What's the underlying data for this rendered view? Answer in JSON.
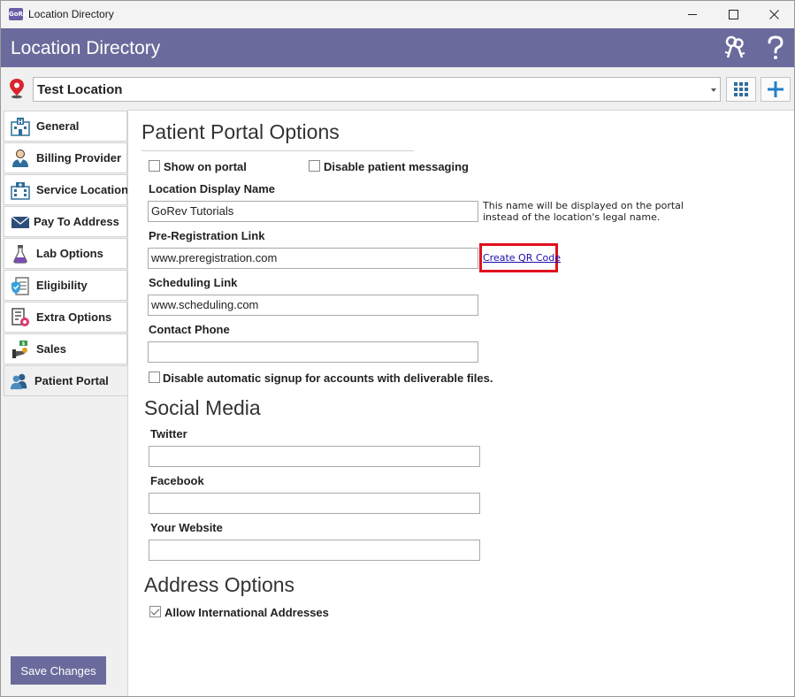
{
  "window": {
    "title": "Location Directory",
    "app_icon_text": "GoRev"
  },
  "header": {
    "title": "Location Directory"
  },
  "location_bar": {
    "selected_location": "Test Location"
  },
  "sidebar": {
    "items": [
      {
        "label": "General",
        "icon": "hospital-icon"
      },
      {
        "label": "Billing Provider",
        "icon": "doctor-icon"
      },
      {
        "label": "Service Location",
        "icon": "building-icon"
      },
      {
        "label": "Pay To Address",
        "icon": "envelope-icon"
      },
      {
        "label": "Lab Options",
        "icon": "flask-icon"
      },
      {
        "label": "Eligibility",
        "icon": "clipboard-shield-icon"
      },
      {
        "label": "Extra Options",
        "icon": "document-gear-icon"
      },
      {
        "label": "Sales",
        "icon": "sales-hand-icon"
      },
      {
        "label": "Patient Portal",
        "icon": "people-icon"
      }
    ],
    "active_item": "Patient Portal",
    "save_label": "Save Changes"
  },
  "patient_portal": {
    "section_title": "Patient Portal Options",
    "show_on_portal": {
      "label": "Show on portal",
      "checked": false
    },
    "disable_messaging": {
      "label": "Disable patient messaging",
      "checked": false
    },
    "display_name": {
      "label": "Location Display Name",
      "value": "GoRev Tutorials",
      "hint_line1": "This name will be displayed on the portal",
      "hint_line2": "instead of the location's legal name."
    },
    "preregistration": {
      "label": "Pre-Registration Link",
      "value": "www.preregistration.com",
      "qr_link": "Create QR Code"
    },
    "scheduling": {
      "label": "Scheduling Link",
      "value": "www.scheduling.com"
    },
    "contact_phone": {
      "label": "Contact Phone",
      "value": ""
    },
    "disable_signup": {
      "label": "Disable automatic signup for accounts with deliverable files.",
      "checked": false
    }
  },
  "social_media": {
    "section_title": "Social Media",
    "twitter": {
      "label": "Twitter",
      "value": ""
    },
    "facebook": {
      "label": "Facebook",
      "value": ""
    },
    "website": {
      "label": "Your Website",
      "value": ""
    }
  },
  "address_options": {
    "section_title": "Address Options",
    "allow_international": {
      "label": "Allow International Addresses",
      "checked": true
    }
  },
  "colors": {
    "header_bg": "#6a6a9c",
    "highlight_box": "#e0101e",
    "link": "#1a0dab",
    "accent_blue": "#1f7fc8"
  }
}
